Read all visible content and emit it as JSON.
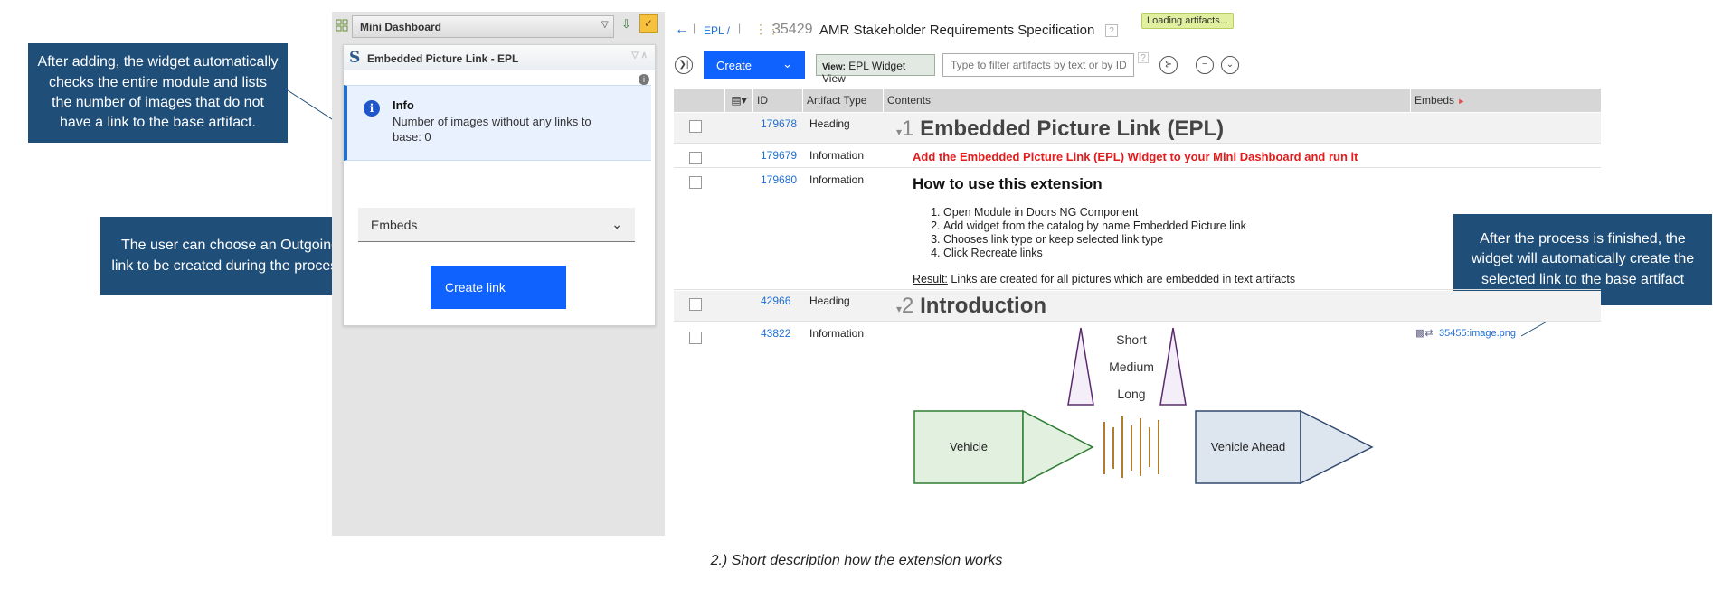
{
  "callouts": {
    "widget_check": "After adding, the widget automatically checks the entire module and lists the number of images that do not have a link to the base artifact.",
    "link_choice": "The user can choose an Outgoing link to be created during the process.",
    "finished": "After the process is finished, the widget will automatically create the selected link to the base artifact"
  },
  "caption": "2.) Short description how the extension works",
  "left_panel": {
    "dashboard_title": "Mini Dashboard",
    "widget_title": "Embedded Picture Link - EPL",
    "info_title": "Info",
    "info_text": "Number of images without any links to base: 0",
    "link_type_value": "Embeds",
    "create_link_label": "Create link"
  },
  "header": {
    "breadcrumb": "EPL /",
    "module_id": "35429",
    "module_title": "AMR Stakeholder Requirements Specification",
    "loading_badge": "Loading artifacts..."
  },
  "toolbar": {
    "create_label": "Create",
    "view_prefix": "View:",
    "view_name": "EPL Widget View",
    "filter_placeholder": "Type to filter artifacts by text or by ID"
  },
  "grid": {
    "columns": [
      "ID",
      "Artifact Type",
      "Contents",
      "Embeds"
    ],
    "rows": [
      {
        "id": "179678",
        "type": "Heading",
        "num": "1",
        "text": "Embedded Picture Link (EPL)"
      },
      {
        "id": "179679",
        "type": "Information",
        "text": "Add the Embedded Picture Link (EPL) Widget to your Mini Dashboard and run it"
      },
      {
        "id": "179680",
        "type": "Information",
        "title": "How to use this extension",
        "steps": [
          "Open Module in Doors NG Component",
          "Add widget from the catalog by name Embedded Picture link",
          "Chooses link type or keep selected link type",
          "Click Recreate links"
        ],
        "result_label": "Result:",
        "result_text": " Links are created for all pictures which are embedded in text artifacts"
      },
      {
        "id": "42966",
        "type": "Heading",
        "num": "2",
        "text": "Introduction"
      },
      {
        "id": "43822",
        "type": "Information",
        "embed_link": "35455:image.png"
      }
    ]
  },
  "diagram": {
    "labels": [
      "Short",
      "Medium",
      "Long"
    ],
    "vehicle": "Vehicle",
    "vehicle_ahead": "Vehicle Ahead",
    "colors": {
      "green_fill": "#e2f1df",
      "green_stroke": "#2e7d32",
      "blue_fill": "#dde5ef",
      "blue_stroke": "#324a6e",
      "purple": "#5b2a6e",
      "wave": "#b07d2c"
    }
  }
}
